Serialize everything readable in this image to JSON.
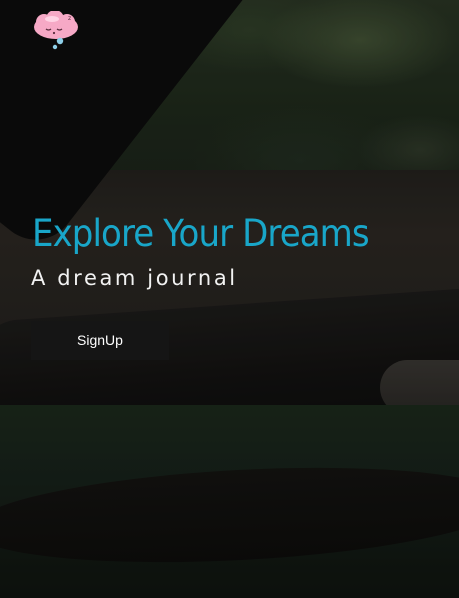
{
  "logo": {
    "icon": "sleeping-cloud-brain-icon",
    "colors": {
      "primary": "#f6a9c6",
      "highlight": "#ffd3e4",
      "bubble": "#8ecfe8"
    }
  },
  "hero": {
    "title": "Explore Your Dreams",
    "subtitle": "A dream journal",
    "signup_label": "SignUp"
  },
  "colors": {
    "accent": "#19a6c9",
    "text": "#f2f2f2",
    "button_bg": "#161616"
  }
}
